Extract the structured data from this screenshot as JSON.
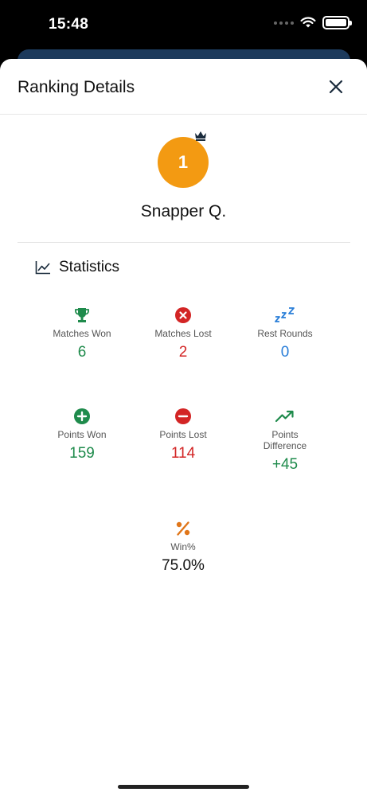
{
  "status": {
    "time": "15:48"
  },
  "sheet": {
    "title": "Ranking Details"
  },
  "player": {
    "rank": "1",
    "name": "Snapper Q."
  },
  "statistics": {
    "title": "Statistics",
    "matches_won": {
      "label": "Matches Won",
      "value": "6"
    },
    "matches_lost": {
      "label": "Matches Lost",
      "value": "2"
    },
    "rest_rounds": {
      "label": "Rest Rounds",
      "value": "0"
    },
    "points_won": {
      "label": "Points Won",
      "value": "159"
    },
    "points_lost": {
      "label": "Points Lost",
      "value": "114"
    },
    "points_difference": {
      "label": "Points Difference",
      "value": "+45"
    },
    "win_percent": {
      "label": "Win%",
      "value": "75.0%"
    }
  },
  "colors": {
    "rank_badge": "#f39a12",
    "positive": "#1f8b4c",
    "negative": "#d32525",
    "rest": "#2a7ed8",
    "win_icon": "#e0761a"
  },
  "icons": [
    "wifi-icon",
    "battery-icon",
    "close-icon",
    "crown-icon",
    "chart-line-icon",
    "trophy-icon",
    "x-circle-icon",
    "sleep-icon",
    "plus-circle-icon",
    "minus-circle-icon",
    "trending-up-icon",
    "percent-icon"
  ]
}
